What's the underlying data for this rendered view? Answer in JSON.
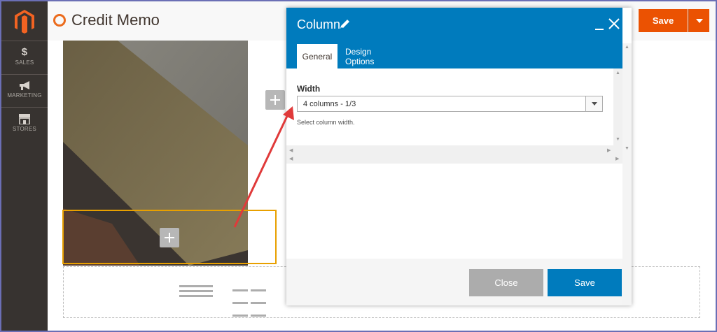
{
  "sidebar": {
    "items": [
      {
        "label": "SALES",
        "icon": "dollar-icon",
        "glyph": "$"
      },
      {
        "label": "MARKETING",
        "icon": "megaphone-icon"
      },
      {
        "label": "STORES",
        "icon": "storefront-icon"
      }
    ]
  },
  "header": {
    "title": "Credit Memo",
    "save_label": "Save"
  },
  "modal": {
    "title": "Column",
    "tabs": [
      {
        "label": "General",
        "active": true
      },
      {
        "label": "Design Options",
        "active": false
      }
    ],
    "width_field": {
      "label": "Width",
      "value": "4 columns - 1/3",
      "note": "Select column width."
    },
    "footer": {
      "close_label": "Close",
      "save_label": "Save"
    }
  },
  "colors": {
    "brand_orange": "#eb5202",
    "modal_blue": "#007bbd",
    "sidebar_dark": "#373330",
    "highlight_outline": "#e8a000",
    "callout_red": "#e03a3a"
  }
}
